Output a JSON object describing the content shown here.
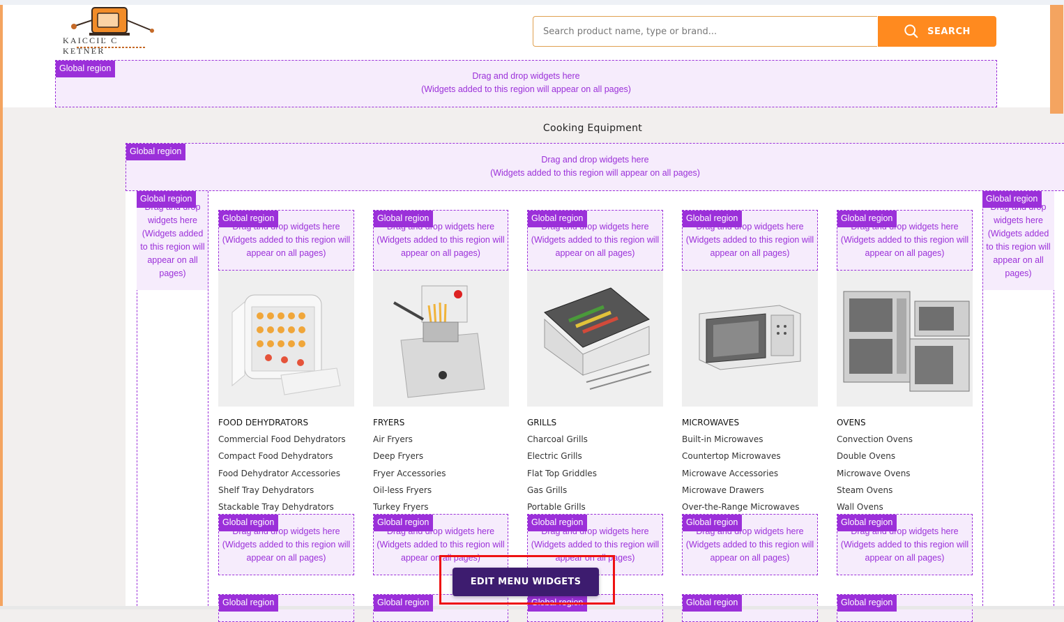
{
  "brand": {
    "logo_text": "KAICCIĽ C KETNER"
  },
  "search": {
    "placeholder": "Search product name, type or brand...",
    "button_label": "SEARCH"
  },
  "region": {
    "badge": "Global region",
    "line1": "Drag and drop widgets here",
    "line2": "(Widgets added to this region will appear on all pages)",
    "side_text": "Drag and drop widgets here (Widgets added to this region will appear on all pages)"
  },
  "page_title": "Cooking Equipment",
  "categories": [
    {
      "title": "FOOD DEHYDRATORS",
      "items": [
        "Commercial Food Dehydrators",
        "Compact Food Dehydrators",
        "Food Dehydrator Accessories",
        "Shelf Tray Dehydrators",
        "Stackable Tray Dehydrators"
      ]
    },
    {
      "title": "FRYERS",
      "items": [
        "Air Fryers",
        "Deep Fryers",
        "Fryer Accessories",
        "Oil-less Fryers",
        "Turkey Fryers"
      ]
    },
    {
      "title": "GRILLS",
      "items": [
        "Charcoal Grills",
        "Electric Grills",
        "Flat Top Griddles",
        "Gas Grills",
        "Portable Grills"
      ]
    },
    {
      "title": "MICROWAVES",
      "items": [
        "Built-in Microwaves",
        "Countertop Microwaves",
        "Microwave Accessories",
        "Microwave Drawers",
        "Over-the-Range Microwaves"
      ]
    },
    {
      "title": "OVENS",
      "items": [
        "Convection Ovens",
        "Double Ovens",
        "Microwave Ovens",
        "Steam Ovens",
        "Wall Ovens"
      ]
    }
  ],
  "edit_button": "EDIT MENU WIDGETS",
  "colors": {
    "accent": "#ff8a1f",
    "region": "#9b30d9",
    "region_bg": "#f6ecfc",
    "edit_button": "#3d1c6f",
    "highlight": "#ee1111"
  }
}
